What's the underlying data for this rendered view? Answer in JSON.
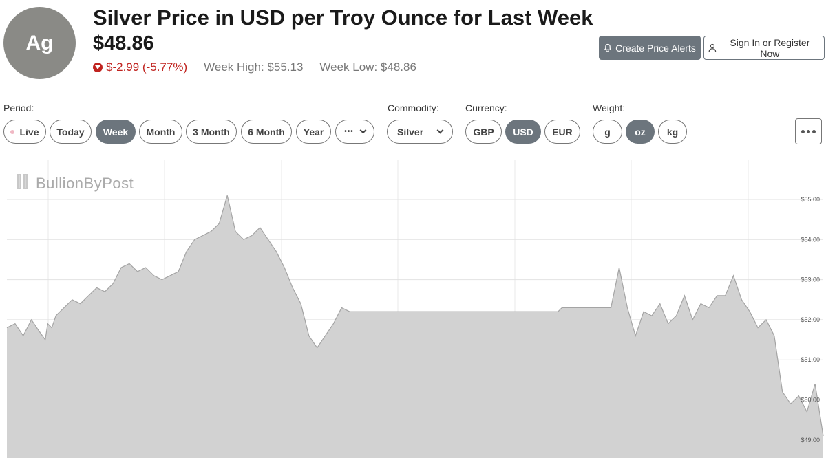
{
  "header": {
    "symbol": "Ag",
    "title": "Silver Price in USD per Troy Ounce for Last Week",
    "price": "$48.86",
    "change": "$-2.99 (-5.77%)",
    "week_high": "Week High: $55.13",
    "week_low": "Week Low: $48.86",
    "alert_button": "Create Price Alerts",
    "signin_button": "Sign In or Register Now"
  },
  "filters": {
    "period_label": "Period:",
    "periods": [
      "Live",
      "Today",
      "Week",
      "Month",
      "3 Month",
      "6 Month",
      "Year"
    ],
    "period_more": "•••",
    "active_period": "Week",
    "commodity_label": "Commodity:",
    "commodity_value": "Silver",
    "currency_label": "Currency:",
    "currencies": [
      "GBP",
      "USD",
      "EUR"
    ],
    "active_currency": "USD",
    "weight_label": "Weight:",
    "weights": [
      "g",
      "oz",
      "kg"
    ],
    "active_weight": "oz"
  },
  "colors": {
    "accent": "#6c757d",
    "down": "#c0231f",
    "area_fill": "#d2d2d2",
    "area_line": "#a4a4a4",
    "avatar": "#8a8a86"
  },
  "chart_data": {
    "type": "area",
    "watermark": "BullionByPost",
    "y_ticks": [
      "$55.00",
      "$54.00",
      "$53.00",
      "$52.00",
      "$51.00",
      "$50.00",
      "$49.00"
    ],
    "ylim": [
      48.75,
      55.75
    ],
    "grid": true,
    "x": [
      0,
      1,
      2,
      3,
      4,
      4.7,
      5,
      5.5,
      6,
      7,
      8,
      9,
      10,
      11,
      12,
      13,
      14,
      15,
      16,
      17,
      18,
      19,
      20,
      21,
      22,
      23,
      24,
      25,
      26,
      27,
      28,
      29,
      30,
      31,
      32,
      33,
      34,
      35,
      36,
      37,
      38,
      39,
      40,
      41,
      42,
      43,
      44,
      45,
      46,
      47,
      48,
      49,
      50,
      51,
      52,
      53,
      54,
      55,
      56,
      57,
      58,
      59,
      60,
      61,
      62,
      63,
      64,
      65,
      66,
      67,
      67.5,
      68,
      69,
      70,
      71,
      72,
      73,
      74,
      75,
      76,
      77,
      78,
      79,
      80,
      81,
      82,
      83,
      84,
      85,
      86,
      87,
      88,
      89,
      90,
      91,
      92,
      93,
      94,
      95,
      96,
      97,
      98,
      99,
      100
    ],
    "values": [
      51.8,
      51.9,
      51.6,
      52.0,
      51.7,
      51.5,
      51.9,
      51.8,
      52.1,
      52.3,
      52.5,
      52.4,
      52.6,
      52.8,
      52.7,
      52.9,
      53.3,
      53.4,
      53.2,
      53.3,
      53.1,
      53.0,
      53.1,
      53.2,
      53.7,
      54.0,
      54.1,
      54.2,
      54.4,
      55.1,
      54.2,
      54.0,
      54.1,
      54.3,
      54.0,
      53.7,
      53.3,
      52.8,
      52.4,
      51.6,
      51.3,
      51.6,
      51.9,
      52.3,
      52.2,
      52.2,
      52.2,
      52.2,
      52.2,
      52.2,
      52.2,
      52.2,
      52.2,
      52.2,
      52.2,
      52.2,
      52.2,
      52.2,
      52.2,
      52.2,
      52.2,
      52.2,
      52.2,
      52.2,
      52.2,
      52.2,
      52.2,
      52.2,
      52.2,
      52.2,
      52.2,
      52.3,
      52.3,
      52.3,
      52.3,
      52.3,
      52.3,
      52.3,
      53.3,
      52.3,
      51.6,
      52.2,
      52.1,
      52.4,
      51.9,
      52.1,
      52.6,
      52.0,
      52.4,
      52.3,
      52.6,
      52.6,
      53.1,
      52.5,
      52.2,
      51.8,
      52.0,
      51.6,
      50.2,
      49.9,
      50.1,
      49.7,
      50.4,
      49.1
    ]
  }
}
